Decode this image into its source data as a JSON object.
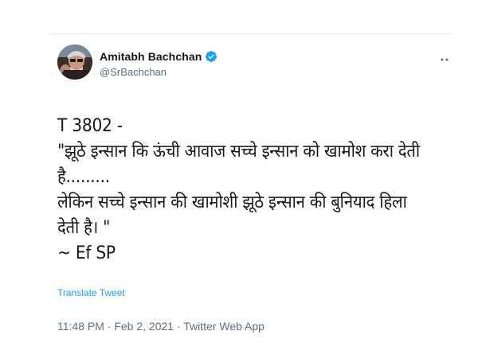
{
  "author": {
    "display_name": "Amitabh Bachchan",
    "handle": "@SrBachchan",
    "verified_icon": "verified-badge-icon",
    "avatar_icon": "profile-photo",
    "more_icon": "more-options-icon"
  },
  "tweet": {
    "lines": [
      "T 3802 -",
      "\"झूठे इन्सान कि ऊंची आवाज सच्चे इन्सान को खामोश करा देती",
      "है.........",
      "लेकिन सच्चे इन्सान की  खामोशी झूठे इन्सान की  बुनियाद हिला",
      "देती है। \"",
      "~ Ef SP"
    ],
    "translate_label": "Translate Tweet",
    "timestamp": "11:48 PM · Feb 2, 2021 · Twitter Web App"
  },
  "colors": {
    "accent": "#1da1f2",
    "text": "#14171a",
    "muted": "#5b7083",
    "divider": "#e6ecf0"
  }
}
